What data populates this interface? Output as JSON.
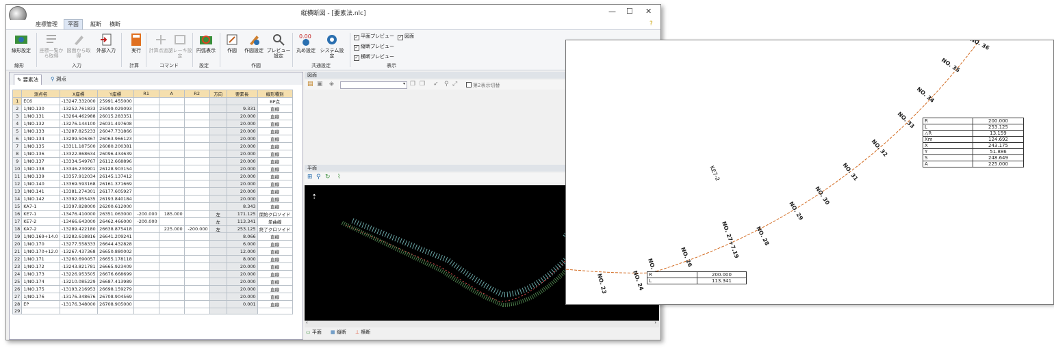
{
  "window": {
    "title": "縦横断図 - [要素法.nlc]",
    "help": "?"
  },
  "ribbon": {
    "tabs": [
      "座標管理",
      "平面",
      "縦断",
      "横断"
    ],
    "active_tab": "平面",
    "buttons": {
      "alignment_settings": "線形設定",
      "coord_list": "座標一覧から取得",
      "from_drawing": "図面から取得",
      "external_input": "外部入力",
      "execute": "実行",
      "add_point": "計算点追加",
      "break_settings": "ブレーキ設定",
      "circle_display": "円弧表示",
      "drawing": "作図",
      "drawing_settings": "作図設定",
      "preview_settings": "プレビュー設定",
      "circle_settings": "丸め設定",
      "system_settings": "システム設定"
    },
    "groups": [
      "線形",
      "入力",
      "計算",
      "コマンド",
      "設定",
      "作図",
      "共通設定",
      "表示"
    ],
    "checks": {
      "plan_preview": "平面プレビュー",
      "drawing": "図面",
      "long_preview": "縦断プレビュー",
      "cross_preview": "横断プレビュー"
    }
  },
  "left_tabs": [
    "要素法",
    "測点"
  ],
  "grid": {
    "columns": [
      "測点名",
      "X座標",
      "Y座標",
      "R1",
      "A",
      "R2",
      "方向",
      "要素長",
      "線形種別"
    ],
    "rows": [
      [
        "1",
        "EC6",
        "-13247.332000",
        "25991.455000",
        "",
        "",
        "",
        "",
        "",
        "BP点"
      ],
      [
        "2",
        "1/NO.130",
        "-13252.761833",
        "25999.029093",
        "",
        "",
        "",
        "",
        "9.331",
        "直線"
      ],
      [
        "3",
        "1/NO.131",
        "-13264.462988",
        "26015.283351",
        "",
        "",
        "",
        "",
        "20.000",
        "直線"
      ],
      [
        "4",
        "1/NO.132",
        "-13276.144100",
        "26031.497608",
        "",
        "",
        "",
        "",
        "20.000",
        "直線"
      ],
      [
        "5",
        "1/NO.133",
        "-13287.825233",
        "26047.731866",
        "",
        "",
        "",
        "",
        "20.000",
        "直線"
      ],
      [
        "6",
        "1/NO.134",
        "-13299.506367",
        "26063.966123",
        "",
        "",
        "",
        "",
        "20.000",
        "直線"
      ],
      [
        "7",
        "1/NO.135",
        "-13311.187500",
        "26080.200381",
        "",
        "",
        "",
        "",
        "20.000",
        "直線"
      ],
      [
        "8",
        "1/NO.136",
        "-13322.868634",
        "26096.434639",
        "",
        "",
        "",
        "",
        "20.000",
        "直線"
      ],
      [
        "9",
        "1/NO.137",
        "-13334.549767",
        "26112.668896",
        "",
        "",
        "",
        "",
        "20.000",
        "直線"
      ],
      [
        "10",
        "1/NO.138",
        "-13346.230901",
        "26128.903154",
        "",
        "",
        "",
        "",
        "20.000",
        "直線"
      ],
      [
        "11",
        "1/NO.139",
        "-13357.912034",
        "26145.137412",
        "",
        "",
        "",
        "",
        "20.000",
        "直線"
      ],
      [
        "12",
        "1/NO.140",
        "-13369.593168",
        "26161.371669",
        "",
        "",
        "",
        "",
        "20.000",
        "直線"
      ],
      [
        "13",
        "1/NO.141",
        "-13381.274301",
        "26177.605927",
        "",
        "",
        "",
        "",
        "20.000",
        "直線"
      ],
      [
        "14",
        "1/NO.142",
        "-13392.955435",
        "26193.840184",
        "",
        "",
        "",
        "",
        "20.000",
        "直線"
      ],
      [
        "15",
        "KA7-1",
        "-13397.828000",
        "26200.612000",
        "",
        "",
        "",
        "",
        "8.343",
        "直線"
      ],
      [
        "16",
        "KE7-1",
        "-13476.410000",
        "26351.063000",
        "-200.000",
        "185.000",
        "",
        "左",
        "171.125",
        "開始クロソイド"
      ],
      [
        "17",
        "KE7-2",
        "-13466.643000",
        "26462.466000",
        "-200.000",
        "",
        "",
        "左",
        "113.341",
        "単曲線"
      ],
      [
        "18",
        "KA7-2",
        "-13289.422180",
        "26638.875418",
        "",
        "225.000",
        "-200.000",
        "左",
        "253.125",
        "終了クロソイド"
      ],
      [
        "19",
        "1/NO.169+14.0",
        "-13282.618816",
        "26641.209241",
        "",
        "",
        "",
        "",
        "8.066",
        "直線"
      ],
      [
        "20",
        "1/NO.170",
        "-13277.558333",
        "26644.432828",
        "",
        "",
        "",
        "",
        "6.000",
        "直線"
      ],
      [
        "21",
        "1/NO.170+12.0",
        "-13267.437368",
        "26650.880002",
        "",
        "",
        "",
        "",
        "12.000",
        "直線"
      ],
      [
        "22",
        "1/NO.171",
        "-13260.690057",
        "26655.178118",
        "",
        "",
        "",
        "",
        "8.000",
        "直線"
      ],
      [
        "23",
        "1/NO.172",
        "-13243.821781",
        "26665.923409",
        "",
        "",
        "",
        "",
        "20.000",
        "直線"
      ],
      [
        "24",
        "1/NO.173",
        "-13226.953505",
        "26676.668699",
        "",
        "",
        "",
        "",
        "20.000",
        "直線"
      ],
      [
        "25",
        "1/NO.174",
        "-13210.085229",
        "26687.413989",
        "",
        "",
        "",
        "",
        "20.000",
        "直線"
      ],
      [
        "26",
        "1/NO.175",
        "-13193.216953",
        "26698.159279",
        "",
        "",
        "",
        "",
        "20.000",
        "直線"
      ],
      [
        "27",
        "1/NO.176",
        "-13176.348676",
        "26708.904569",
        "",
        "",
        "",
        "",
        "20.000",
        "直線"
      ],
      [
        "28",
        "EP",
        "-13176.348000",
        "26708.905000",
        "",
        "",
        "",
        "",
        "0.001",
        "直線"
      ],
      [
        "29",
        "",
        "",
        "",
        "",
        "",
        "",
        "",
        "",
        ""
      ]
    ]
  },
  "panels": {
    "top_title": "図面",
    "top_check": "第2表示切替",
    "plan_title": "平面",
    "bottom_tabs": [
      "平面",
      "縦断",
      "横断"
    ]
  },
  "overlay": {
    "station_labels": [
      "NO. 23",
      "NO. 24",
      "NO. 25",
      "NO. 26",
      "NO. 27+7.19",
      "NO. 28",
      "NO. 29",
      "NO. 30",
      "NO. 31",
      "NO. 32",
      "NO. 33",
      "NO. 34",
      "NO. 35",
      "NO. 36"
    ],
    "ke_label": "KE7-2",
    "clothoid_table": [
      [
        "R",
        "200.000"
      ],
      [
        "L",
        "253.125"
      ],
      [
        "△R",
        "13.159"
      ],
      [
        "Xm",
        "124.692"
      ],
      [
        "X",
        "243.175"
      ],
      [
        "Y",
        "51.886"
      ],
      [
        "S",
        "248.649"
      ],
      [
        "A",
        "225.000"
      ]
    ],
    "curve_table": [
      [
        "R",
        "200.000"
      ],
      [
        "L",
        "113.341"
      ]
    ]
  },
  "colors": {
    "grid_header": "#f5dfae",
    "alignment_line": "#d2691e",
    "canvas_bg": "#000000",
    "canvas_green": "#5fa05f",
    "canvas_cyan": "#8fe0e0"
  }
}
